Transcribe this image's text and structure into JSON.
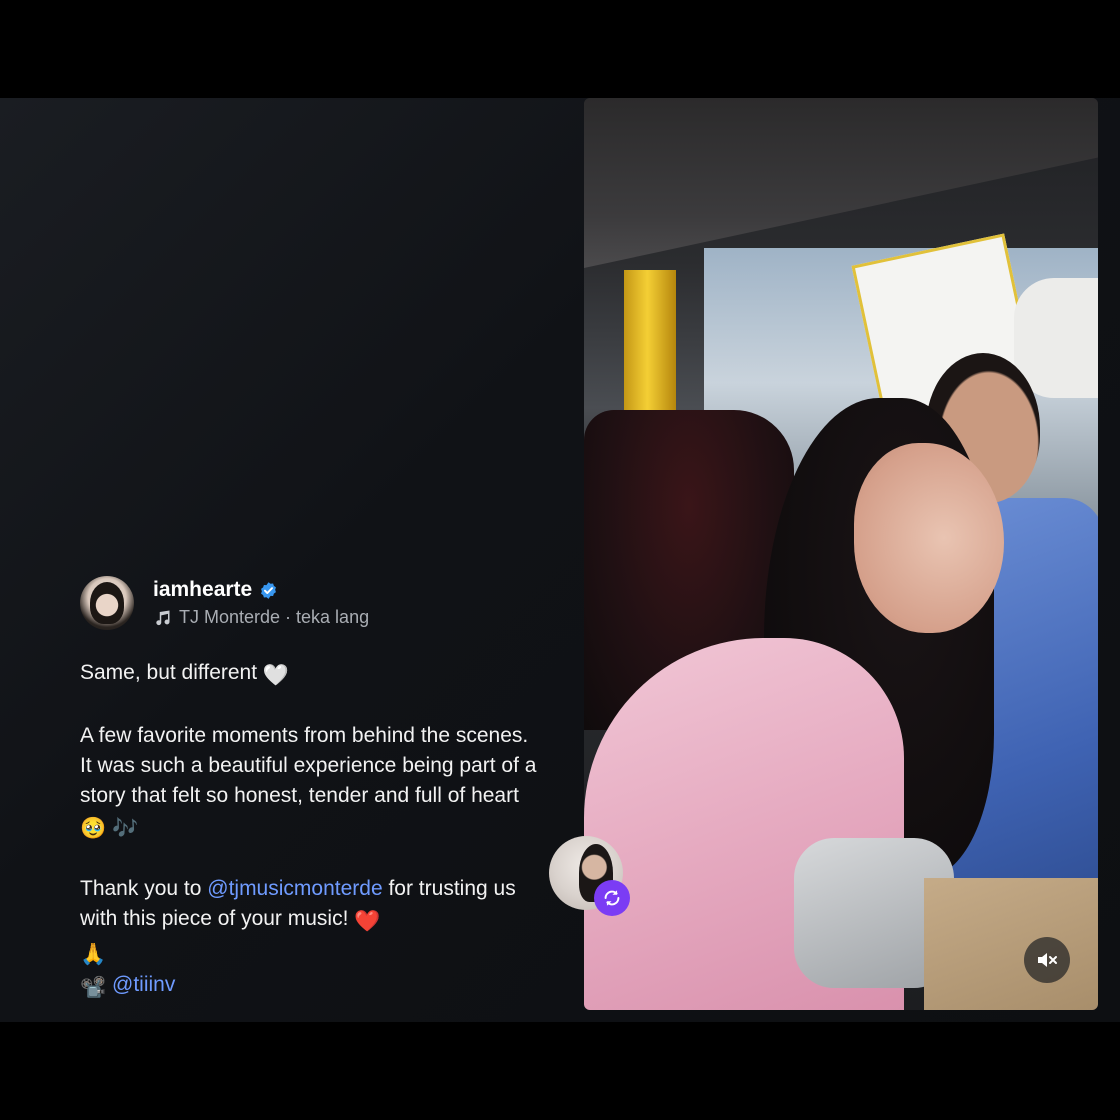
{
  "post": {
    "username": "iamhearte",
    "music": "TJ Monterde · teka lang",
    "caption": {
      "line1": "Same, but different",
      "line1_emoji": "🤍",
      "para2": "A few favorite moments from behind the scenes. It was such a beautiful experience being part of a story that felt so honest, tender and full of heart",
      "para2_emoji": "🥹 🎶",
      "thanks_prefix": "Thank you to",
      "thanks_mention": "@tjmusicmonterde",
      "thanks_suffix": "for trusting us with this piece of your music!",
      "thanks_emoji": "❤️",
      "pray_emoji": "🙏",
      "credit_emoji": "📽️",
      "credit_mention": "@tiiinv"
    }
  },
  "icons": {
    "verified": "verified-badge-icon",
    "music": "music-note-icon",
    "mute": "speaker-muted-icon",
    "remix": "remix-arrows-icon"
  },
  "colors": {
    "mention": "#6f9bff",
    "verified": "#3897f0",
    "remix_badge": "#7b3cf4"
  }
}
